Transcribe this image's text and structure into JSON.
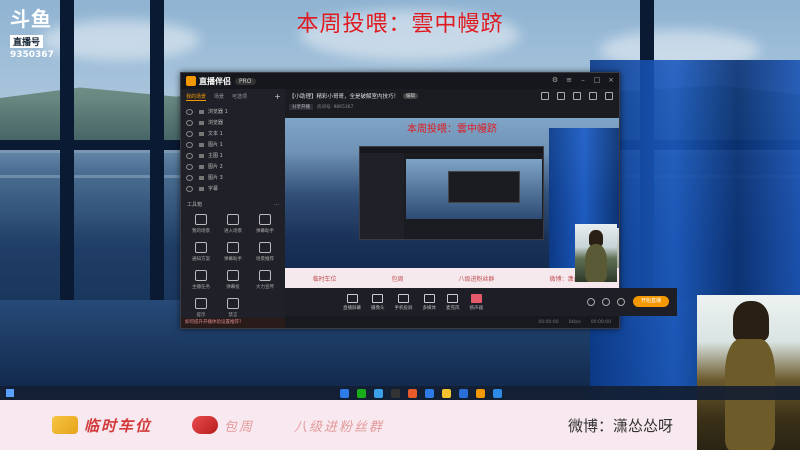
{
  "stream": {
    "banner": "本周投喂：雲中幔跻",
    "logo_brand": "斗鱼",
    "logo_sub": "直播号",
    "room": "9350367"
  },
  "app": {
    "name": "直播伴侣",
    "version": "PRO",
    "left_tabs": [
      "我的场景",
      "场景",
      "可选项"
    ],
    "sources": [
      "浏览器 1",
      "浏览器",
      "文本 1",
      "图片 1",
      "主图 1",
      "图片 2",
      "图片 3",
      "字幕"
    ],
    "tools_title": "工具箱",
    "tools": [
      "我的场景",
      "进入场景",
      "弹幕助手",
      "通知方案",
      "弹幕助手",
      "场景推荐",
      "主播任务",
      "弹幕投",
      "大力宣传",
      "提示",
      "禁言"
    ],
    "footer_tip": "如何提升开播体验设置推荐？",
    "room_title": "【小助理】精彩小哥哥，全是破解室内技巧！",
    "room_chip": "编辑",
    "sub_btn": "分享开播",
    "sub_text": "房间号: 9865367",
    "controls": [
      "直播屏幕",
      "摄像头",
      "手机投屏",
      "多媒体",
      "麦克风",
      "扬声器"
    ],
    "go_live": "开始直播",
    "status": [
      "00:00:00",
      "0kb/s",
      "00:00:00"
    ]
  },
  "preview": {
    "title": "本周投喂：雲中幔跻",
    "strip_items": [
      "临时车位",
      "包周",
      "八级进粉丝群",
      "微博：潇怂怂呀"
    ]
  },
  "bottom_strip": {
    "item1": "临时车位",
    "item2": "包周",
    "item3": "八级进粉丝群",
    "weibo": "微博：潇怂怂呀"
  },
  "colors": {
    "banner_red": "#e0191f",
    "accent": "#f39800",
    "strip_bg": "#f8e8ef"
  }
}
